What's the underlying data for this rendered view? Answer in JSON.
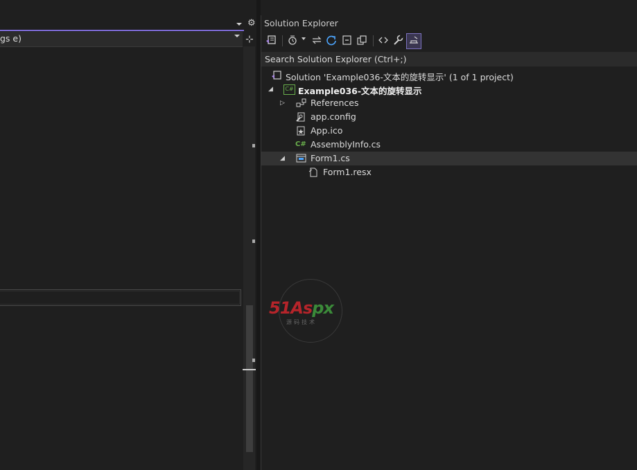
{
  "left_pane": {
    "combo_text": "gs e)"
  },
  "solution_explorer": {
    "title": "Solution Explorer",
    "search_placeholder": "Search Solution Explorer (Ctrl+;)",
    "tree": [
      {
        "label": "Solution 'Example036-文本的旋转显示' (1 of 1 project)",
        "icon": "solution-icon",
        "level": 0
      },
      {
        "label": "Example036-文本的旋转显示",
        "icon": "csharp-project-icon",
        "level": 1,
        "expanded": true
      },
      {
        "label": "References",
        "icon": "references-icon",
        "level": 2,
        "expanded": false
      },
      {
        "label": "app.config",
        "icon": "config-file-icon",
        "level": 2
      },
      {
        "label": "App.ico",
        "icon": "icon-file-icon",
        "level": 2
      },
      {
        "label": "AssemblyInfo.cs",
        "icon": "csharp-file-icon",
        "level": 2
      },
      {
        "label": "Form1.cs",
        "icon": "form-icon",
        "level": 2,
        "expanded": true,
        "selected": true
      },
      {
        "label": "Form1.resx",
        "icon": "resx-file-icon",
        "level": 3
      }
    ]
  },
  "watermark": {
    "part1": "51",
    "part2": "As",
    "part3": "px",
    "sub": "源码技术"
  },
  "colors": {
    "accent": "#7d6bd6",
    "background": "#1f1f1f",
    "csharp_green": "#6ab04c",
    "watermark_red": "#b5242a",
    "watermark_green": "#3b8a39"
  }
}
